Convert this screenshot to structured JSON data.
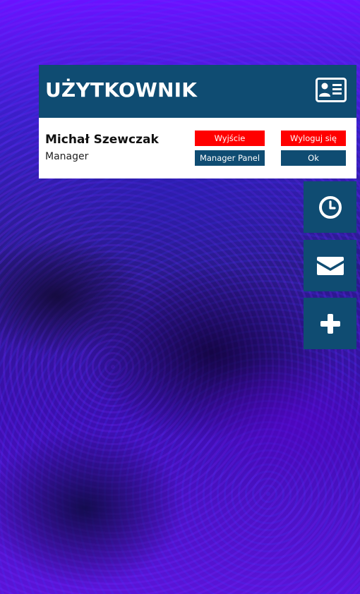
{
  "user_panel": {
    "title": "UŻYTKOWNIK",
    "header_icon": "id-card-icon",
    "user_name": "Michał Szewczak",
    "user_role": "Manager",
    "buttons": {
      "exit_label": "Wyjście",
      "logout_label": "Wyloguj się",
      "manager_panel_label": "Manager Panel",
      "ok_label": "Ok"
    }
  },
  "side_actions": [
    {
      "icon": "clock-icon"
    },
    {
      "icon": "envelope-icon"
    },
    {
      "icon": "plus-icon"
    }
  ],
  "colors": {
    "header_bg": "#0f4c72",
    "danger": "#ff0000",
    "panel_bg": "#ffffff"
  }
}
